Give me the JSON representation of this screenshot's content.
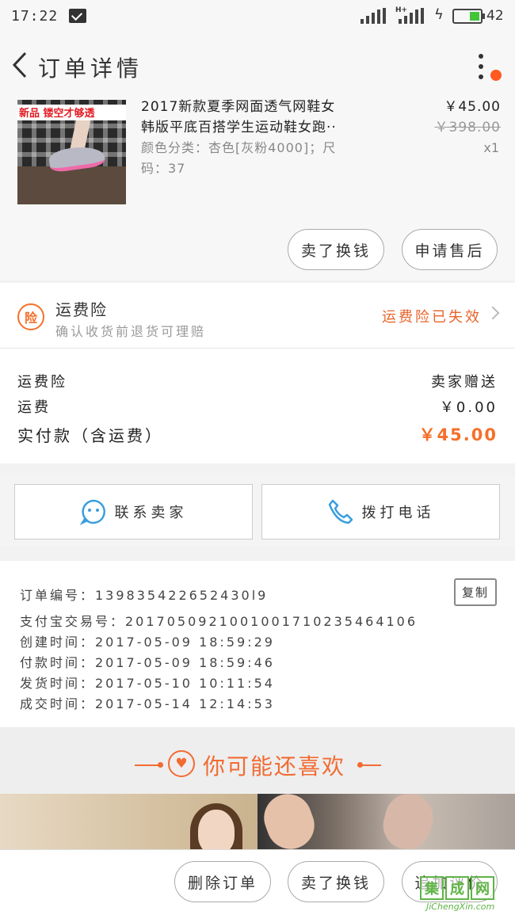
{
  "status_bar": {
    "time": "17:22",
    "network": "H+",
    "battery": "42"
  },
  "header": {
    "title": "订单详情"
  },
  "product": {
    "image_badge": "新品 镂空才够透",
    "title_line1": "2017新款夏季网面透气网鞋女",
    "title_line2": "韩版平底百搭学生运动鞋女跑··",
    "sku_line1": "颜色分类：杏色[灰粉4000]；尺",
    "sku_line2": "码：37",
    "price_now": "￥45.00",
    "price_original": "￥398.00",
    "quantity": "x1",
    "actions": [
      "卖了换钱",
      "申请售后"
    ]
  },
  "insurance": {
    "icon_label": "险",
    "title": "运费险",
    "subtitle": "确认收货前退货可理赔",
    "status": "运费险已失效"
  },
  "fees": {
    "rows": [
      {
        "label": "运费险",
        "value": "卖家赠送"
      },
      {
        "label": "运费",
        "value": "￥0.00"
      }
    ],
    "total_label": "实付款（含运费）",
    "total_value": "￥45.00"
  },
  "contact": {
    "seller_label": "联系卖家",
    "phone_label": "拨打电话"
  },
  "order_info": {
    "order_number": "订单编号：139835422652430l9",
    "copy_label": "复制",
    "lines": [
      "支付宝交易号：2017050921001001710235464106",
      "创建时间：2017-05-09  18:59:29",
      "付款时间：2017-05-09  18:59:46",
      "发货时间：2017-05-10  10:11:54",
      "成交时间：2017-05-14  12:14:53"
    ]
  },
  "recommend": {
    "title": "你可能还喜欢"
  },
  "bottom_actions": [
    "删除订单",
    "卖了换钱",
    "追加评价"
  ],
  "watermark": {
    "chars": [
      "集",
      "成",
      "网"
    ],
    "text": "JiChengXin.com"
  },
  "colors": {
    "accent_orange": "#f5702a",
    "battery_green": "#44c43a",
    "contact_blue": "#3a9ee0"
  }
}
